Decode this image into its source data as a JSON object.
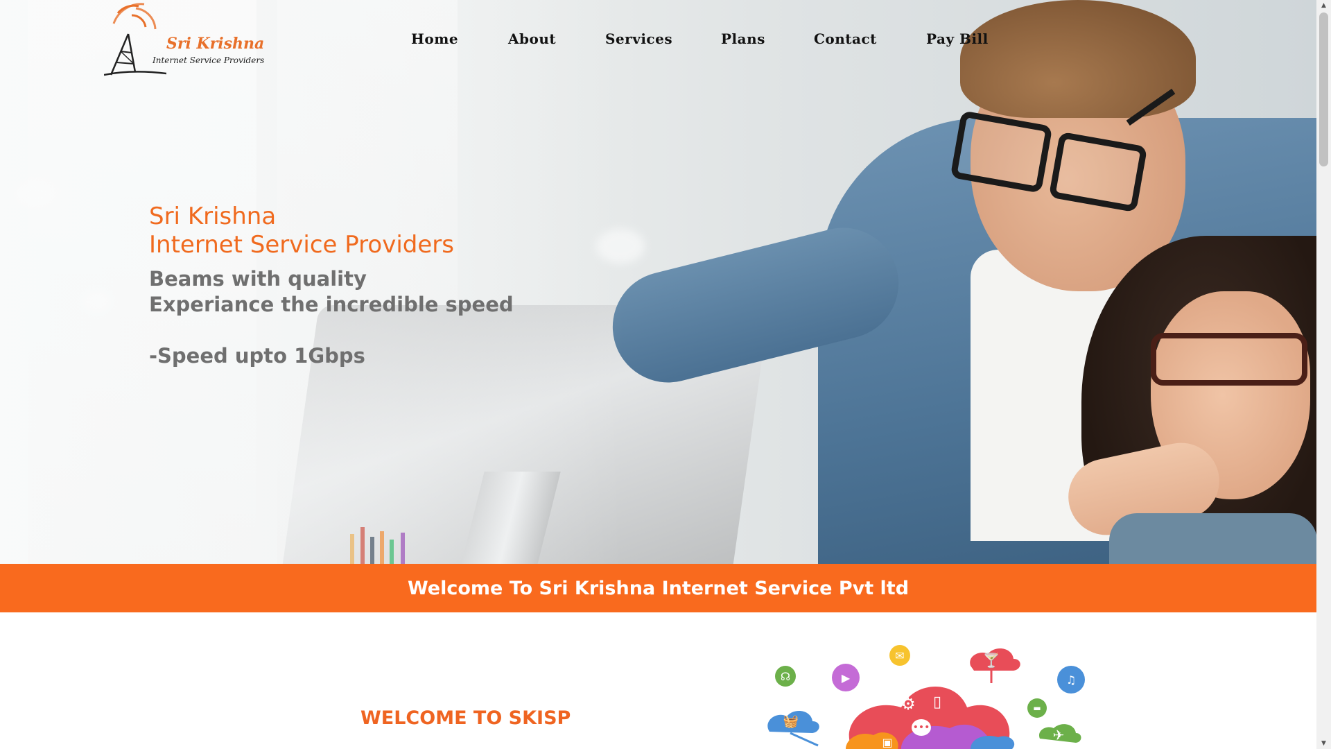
{
  "header": {
    "logo_brand": "Sri Krishna",
    "logo_tagline": "Internet Service Providers",
    "nav": [
      {
        "label": "Home"
      },
      {
        "label": "About"
      },
      {
        "label": "Services"
      },
      {
        "label": "Plans"
      },
      {
        "label": "Contact"
      },
      {
        "label": "Pay Bill"
      }
    ]
  },
  "hero": {
    "title_line1": "Sri Krishna",
    "title_line2": "Internet Service Providers",
    "subtitle_line1": "Beams with quality",
    "subtitle_line2": "Experiance the incredible speed",
    "speed_line": "-Speed upto 1Gbps"
  },
  "banner": {
    "text": "Welcome To Sri Krishna Internet Service Pvt ltd"
  },
  "welcome": {
    "title": "WELCOME TO SKISP"
  },
  "colors": {
    "accent": "#f96a1e",
    "hero_title": "#f06a1e",
    "hero_subtitle": "#6f6f6f"
  },
  "icons": [
    "antenna-tower-icon",
    "headphones-icon",
    "play-icon",
    "mail-icon",
    "cocktail-icon",
    "music-note-icon",
    "car-icon",
    "shopping-basket-icon",
    "gear-icon",
    "mobile-phone-icon",
    "chat-bubble-icon",
    "briefcase-icon",
    "airplane-icon"
  ]
}
